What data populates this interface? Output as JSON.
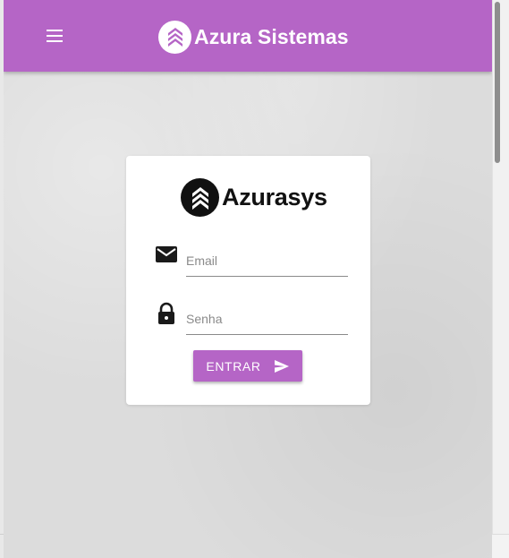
{
  "theme": {
    "brand_color": "#b565c6",
    "card_color": "#ffffff",
    "background_color": "#dcdcdc"
  },
  "appbar": {
    "title": "Azura Sistemas",
    "menu_icon": "menu-icon",
    "logo_icon": "azura-logo-icon"
  },
  "login": {
    "logo_text": "Azurasys",
    "logo_icon": "azurasys-logo-icon",
    "email": {
      "icon": "mail-icon",
      "placeholder": "Email",
      "value": ""
    },
    "password": {
      "icon": "lock-icon",
      "placeholder": "Senha",
      "value": ""
    },
    "submit": {
      "label": "ENTRAR",
      "icon": "send-icon"
    }
  }
}
